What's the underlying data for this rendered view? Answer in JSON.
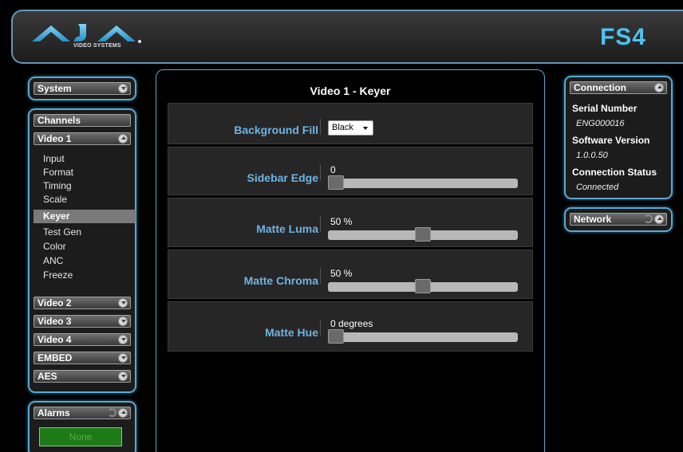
{
  "header": {
    "logo_text": "AJA",
    "logo_subtitle": "VIDEO SYSTEMS",
    "product": "FS4"
  },
  "sidebar": {
    "system": "System",
    "channels": "Channels",
    "video1": "Video 1",
    "video1_items": [
      "Input",
      "Format",
      "Timing",
      "Scale",
      "Keyer",
      "Test Gen",
      "Color",
      "ANC",
      "Freeze"
    ],
    "selected_item": "Keyer",
    "video2": "Video 2",
    "video3": "Video 3",
    "video4": "Video 4",
    "embed": "EMBED",
    "aes": "AES",
    "alarms": "Alarms",
    "alarm_status": "None"
  },
  "main": {
    "title": "Video 1 - Keyer",
    "background_fill": {
      "label": "Background Fill",
      "value": "Black"
    },
    "sidebar_edge": {
      "label": "Sidebar Edge",
      "value": "0",
      "level": 0
    },
    "matte_luma": {
      "label": "Matte Luma",
      "value": "50 %",
      "level": 0.5
    },
    "matte_chroma": {
      "label": "Matte Chroma",
      "value": "50 %",
      "level": 0.5
    },
    "matte_hue": {
      "label": "Matte Hue",
      "value": "0 degrees",
      "level": 0
    }
  },
  "connection": {
    "title": "Connection",
    "serial_label": "Serial Number",
    "serial_value": "ENG000016",
    "software_label": "Software Version",
    "software_value": "1.0.0.50",
    "status_label": "Connection Status",
    "status_value": "Connected"
  },
  "network": {
    "title": "Network"
  },
  "colors": {
    "accent": "#5da6cc",
    "brand": "#4fc2ee",
    "label_blue": "#6fb3e2",
    "alarm_green": "#1e7a16"
  }
}
